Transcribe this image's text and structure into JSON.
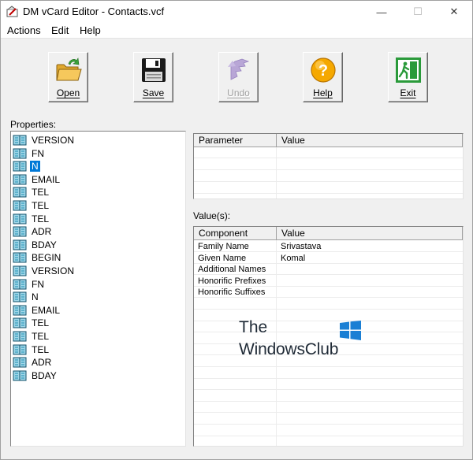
{
  "window": {
    "title": "DM vCard Editor - Contacts.vcf",
    "minimize_glyph": "—",
    "maximize_glyph": "☐",
    "close_glyph": "✕"
  },
  "menu": [
    "Actions",
    "Edit",
    "Help"
  ],
  "toolbar": {
    "open": "Open",
    "save": "Save",
    "undo": "Undo",
    "help": "Help",
    "exit": "Exit"
  },
  "properties": {
    "label": "Properties:",
    "items": [
      "VERSION",
      "FN",
      "N",
      "EMAIL",
      "TEL",
      "TEL",
      "TEL",
      "ADR",
      "BDAY",
      "BEGIN",
      "VERSION",
      "FN",
      "N",
      "EMAIL",
      "TEL",
      "TEL",
      "TEL",
      "ADR",
      "BDAY"
    ],
    "selected_index": 2
  },
  "parameters": {
    "columns": [
      "Parameter",
      "Value"
    ],
    "rows": []
  },
  "values": {
    "label": "Value(s):",
    "columns": [
      "Component",
      "Value"
    ],
    "rows": [
      [
        "Family Name",
        "Srivastava"
      ],
      [
        "Given Name",
        "Komal"
      ],
      [
        "Additional Names",
        ""
      ],
      [
        "Honorific Prefixes",
        ""
      ],
      [
        "Honorific Suffixes",
        ""
      ]
    ]
  },
  "watermark": {
    "line1": "The",
    "line2": "WindowsClub"
  },
  "colors": {
    "selection": "#0078d7",
    "book_icon": "#1e8fb0",
    "help_icon": "#f5a800",
    "exit_icon": "#2a9a3a",
    "watermark_logo": "#1a7fd4"
  },
  "icons": {
    "app": "vcard-app-icon",
    "open": "folder-open-icon",
    "save": "floppy-disk-icon",
    "undo": "undo-icon",
    "help": "help-question-icon",
    "exit": "exit-door-icon",
    "tree": "book-icon"
  }
}
